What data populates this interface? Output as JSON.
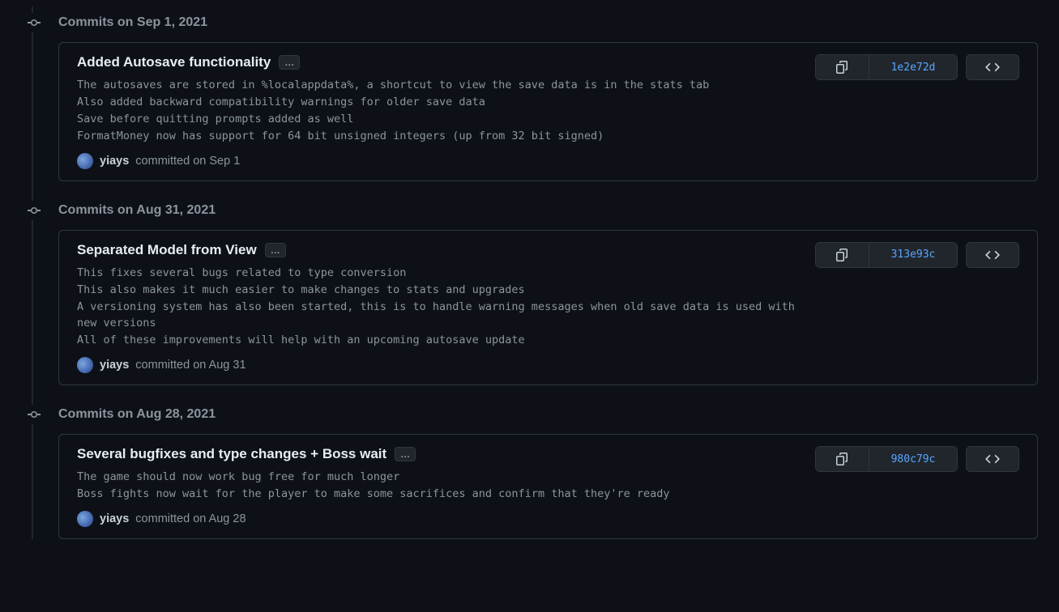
{
  "groups": [
    {
      "label": "Commits on Sep 1, 2021",
      "commits": [
        {
          "title": "Added Autosave functionality",
          "description": "The autosaves are stored in %localappdata%, a shortcut to view the save data is in the stats tab\nAlso added backward compatibility warnings for older save data\nSave before quitting prompts added as well\nFormatMoney now has support for 64 bit unsigned integers (up from 32 bit signed)",
          "author": "yiays",
          "meta_text": "committed on Sep 1",
          "sha": "1e2e72d"
        }
      ]
    },
    {
      "label": "Commits on Aug 31, 2021",
      "commits": [
        {
          "title": "Separated Model from View",
          "description": "This fixes several bugs related to type conversion\nThis also makes it much easier to make changes to stats and upgrades\nA versioning system has also been started, this is to handle warning messages when old save data is used with new versions\nAll of these improvements will help with an upcoming autosave update",
          "author": "yiays",
          "meta_text": "committed on Aug 31",
          "sha": "313e93c"
        }
      ]
    },
    {
      "label": "Commits on Aug 28, 2021",
      "commits": [
        {
          "title": "Several bugfixes and type changes + Boss wait",
          "description": "The game should now work bug free for much longer\nBoss fights now wait for the player to make some sacrifices and confirm that they're ready",
          "author": "yiays",
          "meta_text": "committed on Aug 28",
          "sha": "980c79c"
        }
      ]
    }
  ],
  "ellipsis_label": "…"
}
